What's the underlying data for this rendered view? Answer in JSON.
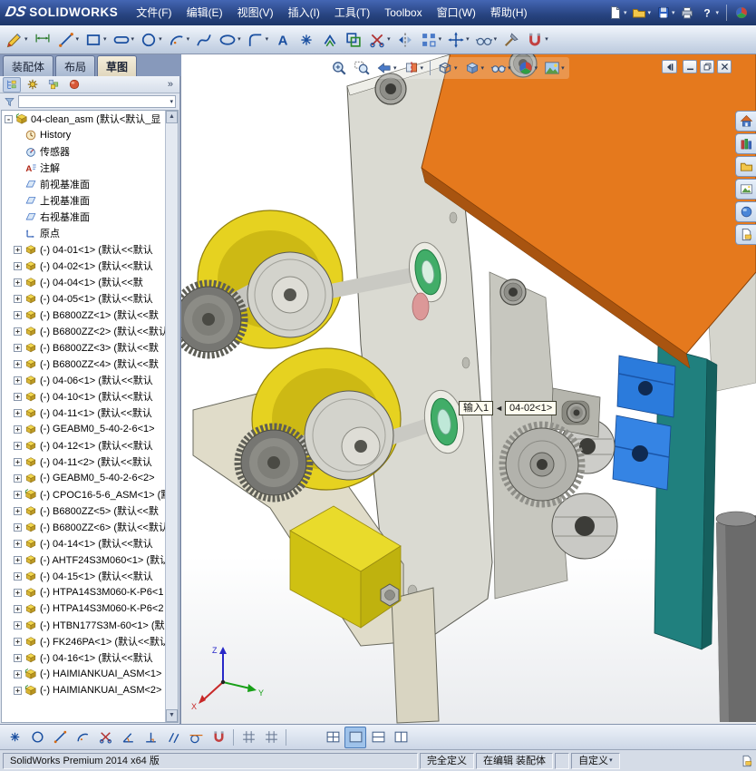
{
  "titlebar": {
    "logo_mark": "DS",
    "logo_text": "SOLIDWORKS",
    "menus": [
      "文件(F)",
      "编辑(E)",
      "视图(V)",
      "插入(I)",
      "工具(T)",
      "Toolbox",
      "窗口(W)",
      "帮助(H)"
    ],
    "quick_icons": [
      {
        "name": "new-document",
        "sym": "s-page",
        "dd": true
      },
      {
        "name": "open",
        "sym": "s-folder",
        "dd": true
      },
      {
        "name": "save",
        "sym": "s-disk",
        "dd": true
      },
      {
        "name": "print",
        "sym": "s-print",
        "dd": false
      },
      {
        "name": "help",
        "sym": "s-question",
        "dd": true
      },
      {
        "sep": true
      },
      {
        "name": "solidworks-resources",
        "sym": "s-ball",
        "dd": false
      }
    ]
  },
  "sketch_toolbar": [
    {
      "name": "sketch",
      "sym": "s-pencil",
      "dd": true
    },
    {
      "name": "smart-dimension",
      "sym": "s-dim",
      "dd": false
    },
    {
      "name": "line",
      "sym": "s-line",
      "dd": true
    },
    {
      "name": "corner-rectangle",
      "sym": "s-rect",
      "dd": true
    },
    {
      "name": "straight-slot",
      "sym": "s-slot",
      "dd": true
    },
    {
      "name": "circle",
      "sym": "s-circle",
      "dd": true
    },
    {
      "name": "centerpoint-arc",
      "sym": "s-arc",
      "dd": true
    },
    {
      "name": "spline",
      "sym": "s-spline",
      "dd": false
    },
    {
      "name": "ellipse",
      "sym": "s-ellipse",
      "dd": true
    },
    {
      "name": "sketch-fillet",
      "sym": "s-fillet",
      "dd": true
    },
    {
      "name": "text",
      "sym": "s-textA",
      "dd": false
    },
    {
      "name": "point",
      "sym": "s-point",
      "dd": false
    },
    {
      "name": "convert-entities",
      "sym": "s-convert",
      "dd": false
    },
    {
      "name": "offset-entities",
      "sym": "s-offset",
      "dd": false
    },
    {
      "name": "trim-entities",
      "sym": "s-trim",
      "dd": true
    },
    {
      "name": "mirror-entities",
      "sym": "s-mirror",
      "dd": false
    },
    {
      "name": "linear-sketch-pattern",
      "sym": "s-pattern",
      "dd": true
    },
    {
      "name": "move-entities",
      "sym": "s-move",
      "dd": true
    },
    {
      "name": "display-delete-relations",
      "sym": "s-relations",
      "dd": true
    },
    {
      "name": "repair-sketch",
      "sym": "s-repair",
      "dd": false
    },
    {
      "name": "quick-snaps",
      "sym": "s-snaps",
      "dd": true
    }
  ],
  "command_tabs": [
    {
      "name": "assembly",
      "label": "装配体",
      "active": false
    },
    {
      "name": "layout",
      "label": "布局",
      "active": false
    },
    {
      "name": "sketch",
      "label": "草图",
      "active": true
    }
  ],
  "feature_panel": {
    "overflow_label": "»",
    "tabs": [
      {
        "name": "featuremanager-tree",
        "sym": "s-fmtree",
        "sel": true
      },
      {
        "name": "propertymanager",
        "sym": "s-fmprop",
        "sel": false
      },
      {
        "name": "configurationmanager",
        "sym": "s-fmconfig",
        "sel": false
      },
      {
        "name": "displaymanager",
        "sym": "s-fmdisplay",
        "sel": false
      }
    ],
    "scroll_up": "▲",
    "scroll_down": "▼",
    "tree": {
      "root": {
        "icon": "s-treeasm",
        "expand": "-",
        "label": "04-clean_asm (默认<默认_显"
      },
      "items": [
        {
          "icon": "s-clock",
          "label": "History"
        },
        {
          "icon": "s-sensor",
          "label": "传感器"
        },
        {
          "icon": "s-annot",
          "label": "注解"
        },
        {
          "icon": "s-plane",
          "label": "前视基准面"
        },
        {
          "icon": "s-plane",
          "label": "上视基准面"
        },
        {
          "icon": "s-plane",
          "label": "右视基准面"
        },
        {
          "icon": "s-origin",
          "label": "原点"
        },
        {
          "icon": "s-treepart",
          "expand": "+",
          "label": "(-) 04-01<1> (默认<<默认"
        },
        {
          "icon": "s-treepart",
          "expand": "+",
          "label": "(-) 04-02<1> (默认<<默认"
        },
        {
          "icon": "s-treepart",
          "expand": "+",
          "label": "(-) 04-04<1> (默认<<默"
        },
        {
          "icon": "s-treepart",
          "expand": "+",
          "label": "(-) 04-05<1> (默认<<默认"
        },
        {
          "icon": "s-treepart",
          "expand": "+",
          "label": "(-) B6800ZZ<1> (默认<<默"
        },
        {
          "icon": "s-treepart",
          "expand": "+",
          "label": "(-) B6800ZZ<2> (默认<<默认"
        },
        {
          "icon": "s-treepart",
          "expand": "+",
          "label": "(-) B6800ZZ<3> (默认<<默"
        },
        {
          "icon": "s-treepart",
          "expand": "+",
          "label": "(-) B6800ZZ<4> (默认<<默"
        },
        {
          "icon": "s-treepart",
          "expand": "+",
          "label": "(-) 04-06<1> (默认<<默认"
        },
        {
          "icon": "s-treepart",
          "expand": "+",
          "label": "(-) 04-10<1> (默认<<默认"
        },
        {
          "icon": "s-treepart",
          "expand": "+",
          "label": "(-) 04-11<1> (默认<<默认"
        },
        {
          "icon": "s-treepart",
          "expand": "+",
          "label": "(-) GEABM0_5-40-2-6<1>"
        },
        {
          "icon": "s-treepart",
          "expand": "+",
          "label": "(-) 04-12<1> (默认<<默认"
        },
        {
          "icon": "s-treepart",
          "expand": "+",
          "label": "(-) 04-11<2> (默认<<默认"
        },
        {
          "icon": "s-treepart",
          "expand": "+",
          "label": "(-) GEABM0_5-40-2-6<2>"
        },
        {
          "icon": "s-treeasm",
          "expand": "+",
          "label": "(-) CPOC16-5-6_ASM<1> (默"
        },
        {
          "icon": "s-treepart",
          "expand": "+",
          "label": "(-) B6800ZZ<5> (默认<<默"
        },
        {
          "icon": "s-treepart",
          "expand": "+",
          "label": "(-) B6800ZZ<6> (默认<<默认"
        },
        {
          "icon": "s-treepart",
          "expand": "+",
          "label": "(-) 04-14<1> (默认<<默认"
        },
        {
          "icon": "s-treepart",
          "expand": "+",
          "label": "(-) AHTF24S3M060<1> (默认"
        },
        {
          "icon": "s-treepart",
          "expand": "+",
          "label": "(-) 04-15<1> (默认<<默认"
        },
        {
          "icon": "s-treepart",
          "expand": "+",
          "label": "(-) HTPA14S3M060-K-P6<1"
        },
        {
          "icon": "s-treepart",
          "expand": "+",
          "label": "(-) HTPA14S3M060-K-P6<2"
        },
        {
          "icon": "s-treepart",
          "expand": "+",
          "label": "(-) HTBN177S3M-60<1> (默"
        },
        {
          "icon": "s-treepart",
          "expand": "+",
          "label": "(-) FK246PA<1> (默认<<默认"
        },
        {
          "icon": "s-treepart",
          "expand": "+",
          "label": "(-) 04-16<1> (默认<<默认"
        },
        {
          "icon": "s-treeasm",
          "expand": "+",
          "label": "(-) HAIMIANKUAI_ASM<1>"
        },
        {
          "icon": "s-treeasm",
          "expand": "+",
          "label": "(-) HAIMIANKUAI_ASM<2>"
        }
      ]
    }
  },
  "viewport": {
    "headsup": [
      {
        "name": "zoom-to-fit",
        "sym": "s-zoomfit",
        "dd": false
      },
      {
        "name": "zoom-to-area",
        "sym": "s-zoomarea",
        "dd": false
      },
      {
        "name": "previous-view",
        "sym": "s-prevview",
        "dd": true
      },
      {
        "name": "section-view",
        "sym": "s-section",
        "dd": true
      },
      {
        "sep": true
      },
      {
        "name": "view-orientation",
        "sym": "s-cube",
        "dd": true
      },
      {
        "name": "display-style",
        "sym": "s-shadedcube",
        "dd": true
      },
      {
        "name": "hide-show-items",
        "sym": "s-glasses",
        "dd": true
      },
      {
        "name": "edit-appearance",
        "sym": "s-ball",
        "dd": true
      },
      {
        "name": "apply-scene",
        "sym": "s-scene",
        "dd": true
      }
    ],
    "doc_controls": [
      {
        "name": "document-minimize",
        "sym": "s-min"
      },
      {
        "name": "document-restore",
        "sym": "s-restore"
      },
      {
        "name": "document-close",
        "sym": "s-close"
      }
    ],
    "callout": {
      "label": "输入1",
      "arrow": "◄",
      "target": "04-02<1>"
    },
    "triad": {
      "x": "X",
      "y": "Y",
      "z": "Z"
    }
  },
  "task_pane": [
    {
      "name": "solidworks-resources-tab",
      "sym": "s-house"
    },
    {
      "name": "design-library-tab",
      "sym": "s-library"
    },
    {
      "name": "file-explorer-tab",
      "sym": "s-folder"
    },
    {
      "name": "view-palette-tab",
      "sym": "s-picture"
    },
    {
      "name": "appearances-scenes-tab",
      "sym": "s-sphere"
    },
    {
      "name": "custom-properties-tab",
      "sym": "s-doctag"
    }
  ],
  "bottom_toolbar": [
    {
      "name": "snap-points",
      "sym": "s-point"
    },
    {
      "name": "snap-center-points",
      "sym": "s-circle"
    },
    {
      "name": "snap-mid-points",
      "sym": "s-line"
    },
    {
      "name": "snap-quadrant-points",
      "sym": "s-arc"
    },
    {
      "name": "snap-intersections",
      "sym": "s-trim"
    },
    {
      "name": "snap-angle",
      "sym": "s-angle"
    },
    {
      "name": "snap-perpendicular",
      "sym": "s-perp"
    },
    {
      "name": "snap-parallel",
      "sym": "s-par"
    },
    {
      "name": "snap-tangent",
      "sym": "s-tan"
    },
    {
      "name": "snap-nearest",
      "sym": "s-snaps"
    },
    {
      "sep": true
    },
    {
      "name": "grid-settings",
      "sym": "s-grid"
    },
    {
      "name": "snap-to-grid",
      "sym": "s-grid"
    },
    {
      "sep": true
    },
    {
      "gap": true
    },
    {
      "name": "viewport-four",
      "sym": "s-vp4"
    },
    {
      "name": "viewport-single",
      "sym": "s-vp1",
      "active": true
    },
    {
      "name": "viewport-two-horizontal",
      "sym": "s-vp2h"
    },
    {
      "name": "viewport-two-vertical",
      "sym": "s-vp2"
    }
  ],
  "status_bar": {
    "product": "SolidWorks Premium 2014 x64 版",
    "define_state": "完全定义",
    "edit_state": "在编辑 装配体",
    "custom_label": "自定义"
  }
}
